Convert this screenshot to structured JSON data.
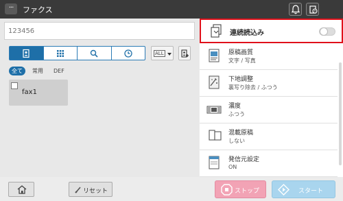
{
  "topbar": {
    "menu_label": "···",
    "title": "ファクス",
    "icons": [
      "bell-icon",
      "device-status-icon"
    ]
  },
  "left": {
    "search": {
      "placeholder": "123456"
    },
    "tabs": [
      "address-book-icon",
      "keypad-icon",
      "search-icon",
      "history-icon"
    ],
    "all_dropdown_label": "ALL",
    "filters": {
      "all": "全て",
      "common": "常用",
      "def": "DEF"
    },
    "destination": {
      "name": "fax1"
    }
  },
  "right": {
    "continuous_scan": {
      "label": "連続読込み",
      "enabled": false
    },
    "settings": [
      {
        "title": "原稿画質",
        "value": "文字 / 写真",
        "icon": "original-quality-icon"
      },
      {
        "title": "下地調整",
        "value": "裏写り除去 / ふつう",
        "icon": "background-adjust-icon"
      },
      {
        "title": "濃度",
        "value": "ふつう",
        "icon": "density-icon"
      },
      {
        "title": "混載原稿",
        "value": "しない",
        "icon": "mixed-original-icon"
      },
      {
        "title": "発信元設定",
        "value": "ON",
        "icon": "sender-setting-icon"
      }
    ]
  },
  "bottom": {
    "reset_label": "リセット",
    "stop_label": "ストップ",
    "start_label": "スタート"
  },
  "colors": {
    "accent": "#1e6fa8",
    "highlight_border": "#e0101a",
    "stop": "#f2a3b5",
    "start": "#a9d5ee"
  }
}
